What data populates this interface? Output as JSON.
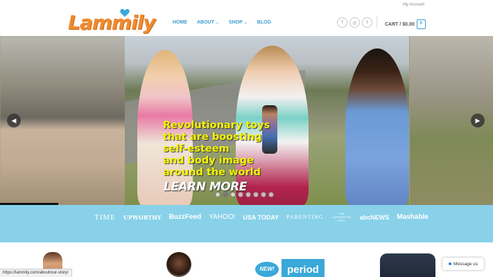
{
  "header": {
    "account_link": "My Account",
    "logo_text": "Lammily",
    "nav": [
      {
        "label": "HOME",
        "dropdown": false
      },
      {
        "label": "ABOUT",
        "dropdown": true
      },
      {
        "label": "SHOP",
        "dropdown": true
      },
      {
        "label": "BLOG",
        "dropdown": false
      }
    ],
    "social": [
      {
        "icon": "facebook-icon",
        "glyph": "f"
      },
      {
        "icon": "instagram-icon",
        "glyph": "◎"
      },
      {
        "icon": "twitter-icon",
        "glyph": "t"
      }
    ],
    "cart_label": "CART / $0.00",
    "cart_count": "0"
  },
  "hero": {
    "headline_lines": [
      "Revolutionary toys",
      "that are boosting",
      "self-esteem",
      "and body image",
      "around the world"
    ],
    "cta": "LEARN MORE",
    "prev_icon": "chevron-left-icon",
    "next_icon": "chevron-right-icon",
    "slide_count": 8,
    "active_slide": 1
  },
  "press": {
    "logos": [
      "TIME",
      "UPWORTHY",
      "BuzzFeed",
      "YAHOO!",
      "USA TODAY",
      "PARENTING",
      "THE HUFFINGTON POST",
      "abcNEWS",
      "Mashable"
    ]
  },
  "products": {
    "badge_new": "NEW!",
    "period_label": "period"
  },
  "status_bar": {
    "url": "https://lammily.com/about/our-story/"
  },
  "chat": {
    "label": "Message us"
  },
  "colors": {
    "accent": "#3a9fd0",
    "logo_orange": "#f08a2e",
    "press_bar": "#88d1e9",
    "headline_yellow": "#f6f400"
  }
}
